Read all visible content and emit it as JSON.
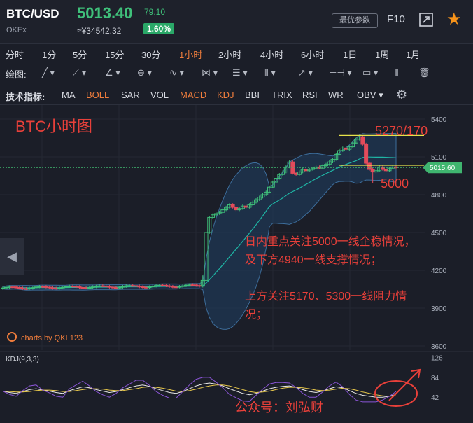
{
  "header": {
    "symbol": "BTC/USD",
    "exchange": "OKEx",
    "price": "5013.40",
    "change": "79.10",
    "price_cny": "≈¥34542.32",
    "change_pct": "1.60%",
    "params_label": "最优参数",
    "f10_label": "F10"
  },
  "timeframes": {
    "items": [
      "分时",
      "1分",
      "5分",
      "15分",
      "30分",
      "1小时",
      "2小时",
      "4小时",
      "6小时",
      "1日",
      "1周",
      "1月"
    ],
    "active": "1小时"
  },
  "drawing": {
    "label": "绘图:"
  },
  "indicators": {
    "label": "技术指标:",
    "items": [
      "MA",
      "BOLL",
      "SAR",
      "VOL",
      "MACD",
      "KDJ",
      "BBI",
      "TRIX",
      "RSI",
      "WR",
      "OBV"
    ],
    "active": [
      "BOLL",
      "MACD",
      "KDJ"
    ]
  },
  "annotations": {
    "title": "BTC小时图",
    "upper": "5270/170",
    "lower": "5000",
    "note1_line1": "日内重点关注5000一线企稳情况，",
    "note1_line2": "及下方4940一线支撑情况；",
    "note2_line1": "上方关注5170、5300一线阻力情",
    "note2_line2": "况；",
    "signature": "公众号：刘弘财"
  },
  "watermark": "charts by QKL123",
  "colors": {
    "up": "#3fc07a",
    "down": "#e24b5b",
    "boll_mid": "#1fb5a5",
    "boll_band": "#3d6e9c",
    "kdj_k": "#e8e8e8",
    "kdj_d": "#e6c64a",
    "kdj_j": "#8a55d6",
    "annot_red": "#e8403a",
    "price_tag": "#3fb56f",
    "accent": "#f07d3c"
  },
  "chart_data": [
    {
      "type": "candlestick",
      "y_ticks": [
        3600,
        3900,
        4200,
        4500,
        4800,
        5100,
        5400
      ],
      "ylim": [
        3600,
        5400
      ],
      "last_price_label": "5015.60",
      "last_price": 5015.6,
      "levels": [
        5270,
        5000
      ],
      "indicator": "BOLL"
    },
    {
      "type": "line",
      "title": "KDJ(9,3,3)",
      "y_ticks": [
        42,
        84,
        126
      ],
      "ylim": [
        20,
        130
      ],
      "series": [
        {
          "name": "K",
          "values": [
            55,
            52,
            50,
            54,
            58,
            60,
            57,
            55,
            52,
            50,
            56,
            60,
            64,
            62,
            58,
            55,
            52,
            54,
            58,
            62,
            66,
            68,
            65,
            60,
            56,
            52,
            50,
            54,
            60,
            66,
            70,
            72,
            70,
            66,
            60,
            55,
            50,
            47,
            50,
            55,
            60,
            63,
            65,
            66,
            63,
            58,
            54,
            52,
            55,
            60,
            64,
            62,
            56,
            50,
            46,
            44,
            42,
            42,
            44,
            48
          ]
        },
        {
          "name": "D",
          "values": [
            55,
            54,
            53,
            53,
            54,
            56,
            57,
            57,
            56,
            54,
            54,
            56,
            58,
            60,
            60,
            59,
            57,
            56,
            56,
            58,
            60,
            63,
            64,
            63,
            61,
            58,
            55,
            54,
            56,
            59,
            63,
            66,
            68,
            68,
            66,
            62,
            58,
            54,
            52,
            53,
            55,
            58,
            61,
            63,
            63,
            62,
            60,
            57,
            56,
            57,
            59,
            61,
            60,
            57,
            53,
            50,
            47,
            45,
            44,
            45
          ]
        },
        {
          "name": "J",
          "values": [
            55,
            48,
            44,
            56,
            66,
            68,
            57,
            51,
            44,
            42,
            60,
            68,
            76,
            66,
            54,
            47,
            42,
            50,
            62,
            70,
            78,
            78,
            67,
            54,
            46,
            40,
            40,
            54,
            68,
            80,
            84,
            84,
            74,
            62,
            48,
            41,
            34,
            33,
            46,
            59,
            70,
            73,
            73,
            72,
            63,
            50,
            42,
            42,
            53,
            66,
            74,
            64,
            48,
            36,
            32,
            32,
            32,
            36,
            44,
            54
          ]
        }
      ]
    }
  ]
}
